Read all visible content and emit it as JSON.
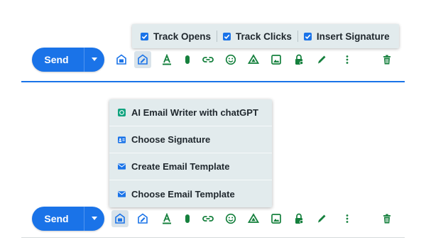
{
  "tracking_popup": {
    "options": [
      {
        "label": "Track Opens",
        "checked": true
      },
      {
        "label": "Track Clicks",
        "checked": true
      },
      {
        "label": "Insert Signature",
        "checked": true
      }
    ]
  },
  "top_compose": {
    "send_label": "Send",
    "toolbar_icons": [
      "template-icon",
      "signature-icon",
      "text-format-icon",
      "attach-icon",
      "link-icon",
      "emoji-icon",
      "drive-icon",
      "photo-icon",
      "confidential-lock-icon",
      "pen-icon",
      "more-options-icon",
      "delete-icon"
    ]
  },
  "menu": {
    "items": [
      {
        "label": "AI Email Writer with chatGPT",
        "icon": "chatgpt-icon"
      },
      {
        "label": "Choose Signature",
        "icon": "signature-card-icon"
      },
      {
        "label": "Create Email Template",
        "icon": "envelope-icon"
      },
      {
        "label": "Choose Email Template",
        "icon": "envelope-icon"
      }
    ]
  },
  "bottom_compose": {
    "send_label": "Send"
  },
  "colors": {
    "accent": "#1a73e8",
    "icon_green": "#15803d",
    "popup_bg": "#e2ebed",
    "text": "#20282e"
  }
}
